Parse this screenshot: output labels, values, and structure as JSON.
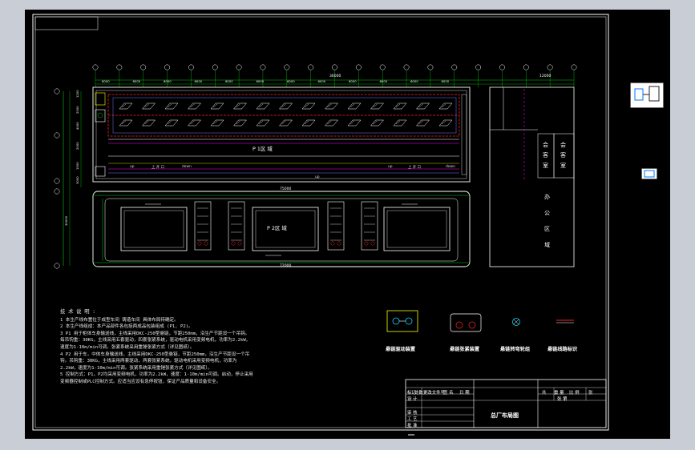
{
  "app": {
    "viewport_bg": "#000000",
    "frame_bg": "#c9ced6",
    "line_color": "#ffffff",
    "accent_green": "#00d200",
    "accent_red": "#ff2020",
    "accent_magenta": "#ff00ff",
    "accent_yellow": "#ffff00"
  },
  "plan": {
    "dimension_total": "36000",
    "dimension_right": "12000",
    "bay_dims": [
      "6000",
      "6000",
      "6000",
      "6000",
      "6000",
      "6000",
      "6000",
      "6000",
      "6000",
      "6000",
      "6000",
      "6000"
    ],
    "dim_lower_total": "75000",
    "p1_label": "P 1区 域",
    "p2_label": "P 2区 域",
    "row_dims_p2": [
      "20000",
      "20000",
      "20000"
    ],
    "dim_p2_bottom": "72000",
    "left_dims": [
      "1200",
      "2000",
      "4000",
      "2000",
      "1500",
      "30000",
      "3000"
    ],
    "up_labels": [
      "up",
      "up",
      "up"
    ],
    "down_labels": [
      "down",
      "down"
    ],
    "gate_labels": [
      "上 开 口",
      "上 开 口"
    ],
    "office_room_1": "会 客 室",
    "office_room_2": "会 客 室",
    "office_area": "办 公 区 域"
  },
  "notes": {
    "title": "技 术 说 明 :",
    "lines": [
      "1 本生产线布置位于成型车间 铸造车间 具体布局待确定。",
      "2 本生产线组成：本产品部件各包括两成品包装组成 (P1, P2)。",
      "3 P1 用于柜体车身输送线，主线采用DKC-250型悬链，节距250mm，沿生产节距设一个吊钩。",
      "  每吊钩重：30KG，主线采用五套驱动，四套张紧系统，驱动电机采用变频电机，功率为2.2kW，",
      "  速度为1-10m/min可调。张紧系统采用重锤张紧方式（详见图纸）。",
      "4 P2 用于车，中体车身输送线，主线采用DKC-250型悬链，节距250mm，沿生产节距设一个吊",
      "  钩。吊钩重：30KG，主线采用两套驱动，两套张紧系统，驱动电机采用变频电机，功率为",
      "  2.2kW，速度为1-10m/min可调。张紧系统采用重锤张紧方式（详见图纸）。",
      "5 控制方式：P1，P2均采用变频电机，功率为2.2kW，速度：1-10m/min可调。启动，停止采用",
      "  变频器控制或PLC控制方式。应适当应设有急停按钮，保证产品质量和设备安全。"
    ]
  },
  "legend": [
    {
      "label": "悬链驱动装置"
    },
    {
      "label": "悬链张紧装置"
    },
    {
      "label": "悬链转弯轮组"
    },
    {
      "label": "悬链线路标识"
    }
  ],
  "titleblock": {
    "row_headers": [
      "标记",
      "处数",
      "更改文件号",
      "签 名",
      "日 期"
    ],
    "left_rows": [
      "设 计",
      "审 核",
      "工 艺",
      "批 准"
    ],
    "drawing_title": "总厂布局图",
    "right_top": [
      "共",
      "张 第",
      "张"
    ],
    "right_labels": [
      "比 例",
      "重 量"
    ]
  }
}
